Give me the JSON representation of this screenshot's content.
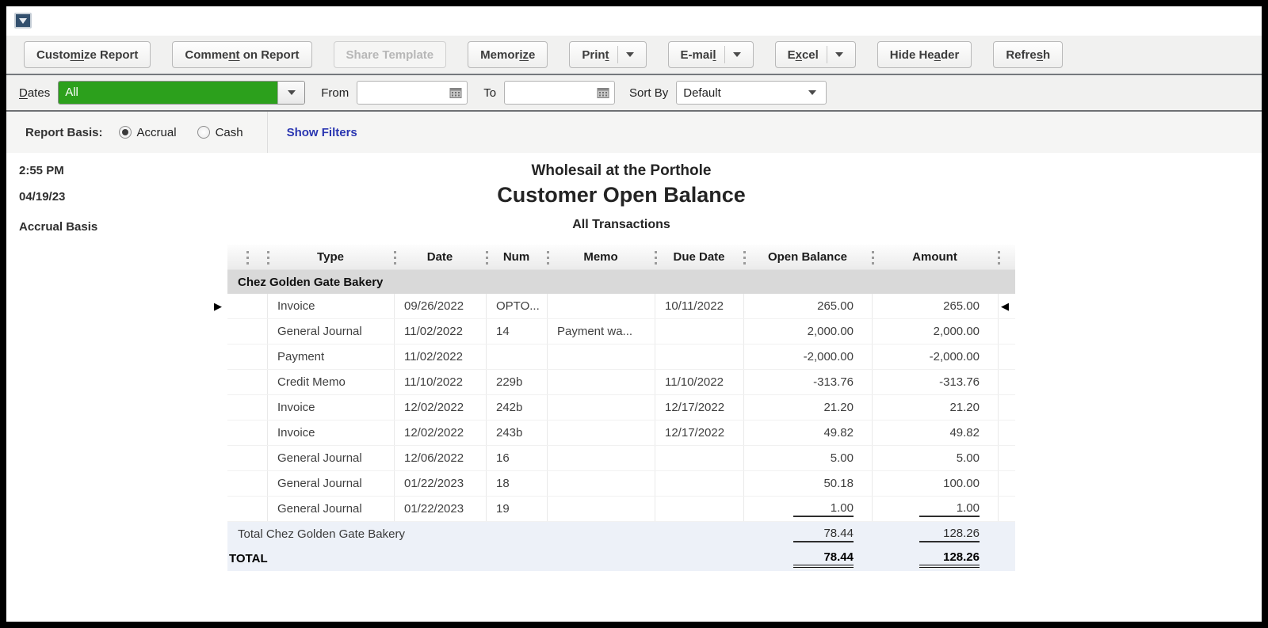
{
  "colors": {
    "titlebar_navy": "#1b2f47",
    "qb_green": "#2CA01C",
    "show_filters_blue": "#2a36b1",
    "group_band_gray": "#d9d9d9",
    "total_band_blue": "#edf1f8"
  },
  "window": {
    "title": "Customer Open Balance"
  },
  "toolbar": {
    "buttons": [
      {
        "pre": "Custo",
        "u": "mi",
        "post": "ze Report"
      },
      {
        "pre": "Comme",
        "u": "nt",
        "post": " on Report"
      },
      {
        "pre": "Share Template",
        "u": "",
        "post": ""
      },
      {
        "pre": "Memor",
        "u": "iz",
        "post": "e"
      },
      {
        "pre": "Prin",
        "u": "t",
        "post": ""
      },
      {
        "pre": "E-mai",
        "u": "l",
        "post": ""
      },
      {
        "pre": "E",
        "u": "x",
        "post": "cel"
      },
      {
        "pre": "Hide He",
        "u": "a",
        "post": "der"
      },
      {
        "pre": "Refre",
        "u": "s",
        "post": "h"
      }
    ]
  },
  "filterbar": {
    "dates_label": {
      "pre": "",
      "u": "D",
      "post": "ates"
    },
    "dates_value": "All",
    "from_label": "From",
    "from_value": "",
    "to_label": "To",
    "to_value": "",
    "sort_by_label": "Sort By",
    "sort_by_value": "Default"
  },
  "basisbar": {
    "label": "Report Basis:",
    "accrual_label": "Accrual",
    "cash_label": "Cash",
    "accrual_selected": true,
    "show_filters": "Show Filters"
  },
  "report": {
    "time": "2:55 PM",
    "date": "04/19/23",
    "basis": "Accrual Basis",
    "company": "Wholesail at the Porthole",
    "title": "Customer Open Balance",
    "subtitle": "All Transactions",
    "table": {
      "headers": [
        "Type",
        "Date",
        "Num",
        "Memo",
        "Due Date",
        "Open Balance",
        "Amount"
      ],
      "group": "Chez Golden Gate Bakery",
      "rows": [
        {
          "type": "Invoice",
          "date": "09/26/2022",
          "num": "OPTO...",
          "memo": "",
          "due_date": "10/11/2022",
          "open_balance": "265.00",
          "amount": "265.00",
          "left_marker": true,
          "right_marker": true
        },
        {
          "type": "General Journal",
          "date": "11/02/2022",
          "num": "14",
          "memo": "Payment wa...",
          "due_date": "",
          "open_balance": "2,000.00",
          "amount": "2,000.00"
        },
        {
          "type": "Payment",
          "date": "11/02/2022",
          "num": "",
          "memo": "",
          "due_date": "",
          "open_balance": "-2,000.00",
          "amount": "-2,000.00"
        },
        {
          "type": "Credit Memo",
          "date": "11/10/2022",
          "num": "229b",
          "memo": "",
          "due_date": "11/10/2022",
          "open_balance": "-313.76",
          "amount": "-313.76"
        },
        {
          "type": "Invoice",
          "date": "12/02/2022",
          "num": "242b",
          "memo": "",
          "due_date": "12/17/2022",
          "open_balance": "21.20",
          "amount": "21.20"
        },
        {
          "type": "Invoice",
          "date": "12/02/2022",
          "num": "243b",
          "memo": "",
          "due_date": "12/17/2022",
          "open_balance": "49.82",
          "amount": "49.82"
        },
        {
          "type": "General Journal",
          "date": "12/06/2022",
          "num": "16",
          "memo": "",
          "due_date": "",
          "open_balance": "5.00",
          "amount": "5.00"
        },
        {
          "type": "General Journal",
          "date": "01/22/2023",
          "num": "18",
          "memo": "",
          "due_date": "",
          "open_balance": "50.18",
          "amount": "100.00"
        },
        {
          "type": "General Journal",
          "date": "01/22/2023",
          "num": "19",
          "memo": "",
          "due_date": "",
          "open_balance": "1.00",
          "amount": "1.00",
          "underline_numbers": true
        }
      ],
      "group_total": {
        "label": "Total Chez Golden Gate Bakery",
        "open_balance": "78.44",
        "amount": "128.26"
      },
      "grand_total": {
        "label": "TOTAL",
        "open_balance": "78.44",
        "amount": "128.26"
      }
    }
  }
}
